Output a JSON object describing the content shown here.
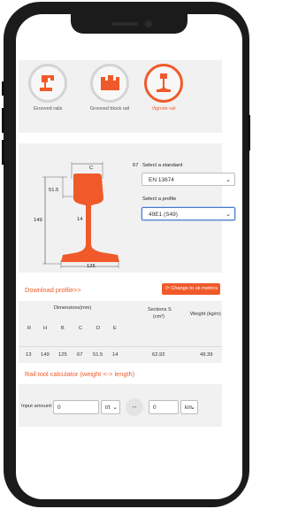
{
  "rail_types": [
    {
      "label": "Grooved rails",
      "active": false
    },
    {
      "label": "Grooved block rail",
      "active": false
    },
    {
      "label": "Vignole rail",
      "active": true
    }
  ],
  "diagram": {
    "dim_c": "C",
    "dim_51_5": "51.5",
    "dim_149": "149",
    "dim_14": "14",
    "dim_125": "125",
    "dim_67": "67"
  },
  "controls": {
    "standard_label": "Select a standard",
    "standard_value": "EN 13674",
    "profile_label": "Select a profile",
    "profile_value": "49E1 (S49)"
  },
  "download_label": "Download profile>>",
  "uk_button_label": "Change to uk metrics",
  "table": {
    "group_header": "Dimensions(mm)",
    "section_header_line1": "Sections S",
    "section_header_line2": "(cm²)",
    "weight_header": "Weight (kg/m)",
    "columns": [
      "R",
      "H",
      "B",
      "C",
      "D",
      "E"
    ],
    "row": [
      "13",
      "149",
      "125",
      "67",
      "51.5",
      "14"
    ],
    "section_value": "62.92",
    "weight_value": "49.39"
  },
  "calc": {
    "title": "Rail tool calculator (weight <-> length)",
    "input_label": "Input amount:",
    "left_value": "0",
    "left_unit": "t/t",
    "arrow": "↔",
    "right_value": "0",
    "right_unit": "km"
  },
  "colors": {
    "accent": "#f05a2a",
    "panel": "#f1f1f1"
  }
}
